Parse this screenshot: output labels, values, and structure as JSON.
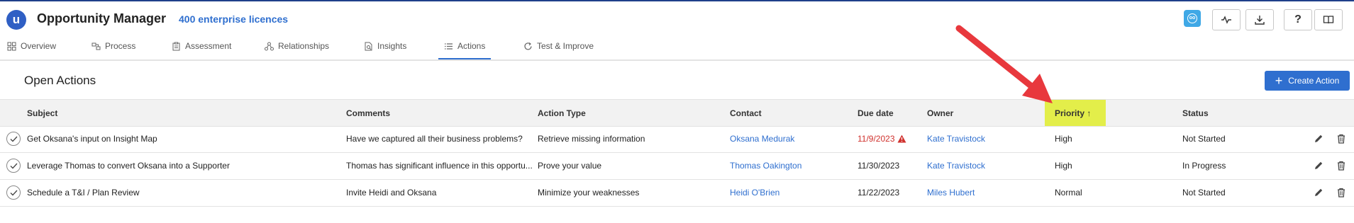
{
  "app": {
    "title": "Opportunity Manager",
    "licences": "400 enterprise licences",
    "logo_letter": "u",
    "user_initials": "oo"
  },
  "header_buttons": [
    {
      "icon": "user-avatar-icon"
    },
    {
      "icon": "activity-icon"
    },
    {
      "icon": "download-icon"
    },
    {
      "icon": "help-icon",
      "label": "?"
    },
    {
      "icon": "book-icon"
    }
  ],
  "tabs": [
    {
      "label": "Overview",
      "icon": "grid-icon",
      "active": false
    },
    {
      "label": "Process",
      "icon": "process-icon",
      "active": false
    },
    {
      "label": "Assessment",
      "icon": "clipboard-icon",
      "active": false
    },
    {
      "label": "Relationships",
      "icon": "relationships-icon",
      "active": false
    },
    {
      "label": "Insights",
      "icon": "insights-icon",
      "active": false
    },
    {
      "label": "Actions",
      "icon": "list-icon",
      "active": true
    },
    {
      "label": "Test & Improve",
      "icon": "refresh-icon",
      "active": false
    }
  ],
  "section": {
    "title": "Open Actions",
    "create_label": "Create Action"
  },
  "table": {
    "columns": [
      "Subject",
      "Comments",
      "Action Type",
      "Contact",
      "Due date",
      "Owner",
      "Priority ↑",
      "Status"
    ],
    "sorted_column": "Priority",
    "rows": [
      {
        "subject": "Get Oksana's input on Insight Map",
        "comments": "Have we captured all their business problems?",
        "action_type": "Retrieve missing information",
        "contact": "Oksana Medurak",
        "due_date": "11/9/2023",
        "overdue": true,
        "owner": "Kate Travistock",
        "priority": "High",
        "status": "Not Started"
      },
      {
        "subject": "Leverage Thomas to convert Oksana into a Supporter",
        "comments": "Thomas has significant influence in this opportu...",
        "action_type": "Prove your value",
        "contact": "Thomas Oakington",
        "due_date": "11/30/2023",
        "overdue": false,
        "owner": "Kate Travistock",
        "priority": "High",
        "status": "In Progress"
      },
      {
        "subject": "Schedule a T&I / Plan Review",
        "comments": "Invite Heidi and Oksana",
        "action_type": "Minimize your weaknesses",
        "contact": "Heidi O'Brien",
        "due_date": "11/22/2023",
        "overdue": false,
        "owner": "Miles Hubert",
        "priority": "Normal",
        "status": "Not Started"
      }
    ]
  },
  "colors": {
    "accent": "#2f6fcf",
    "highlight": "#e3ee4a",
    "overdue": "#d0312d",
    "annotation_arrow": "#e8383d"
  }
}
